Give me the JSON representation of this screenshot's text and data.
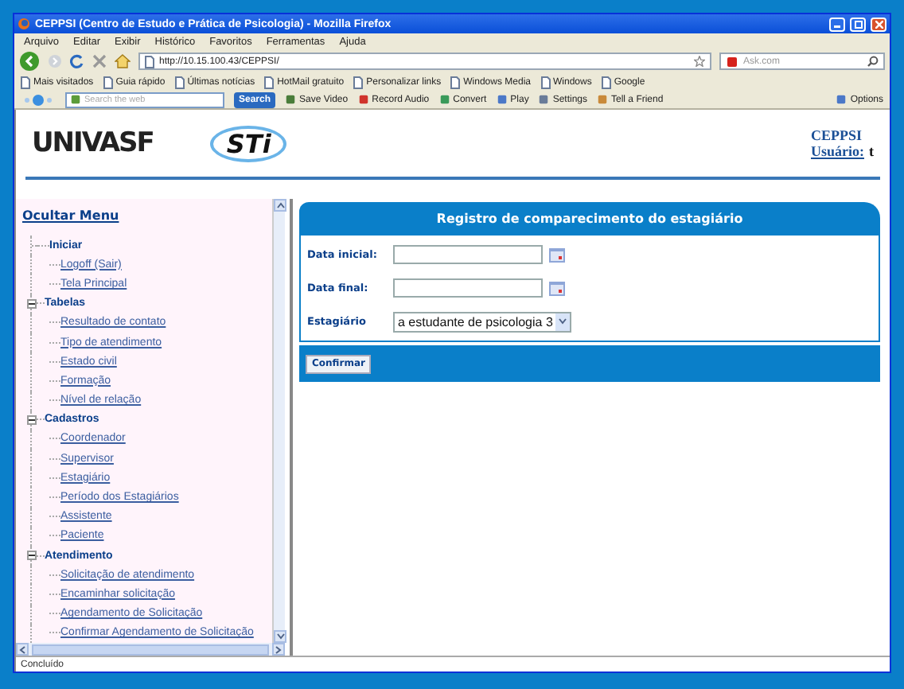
{
  "window": {
    "title": "CEPPSI (Centro de Estudo e Prática de Psicologia) - Mozilla Firefox"
  },
  "menu": [
    "Arquivo",
    "Editar",
    "Exibir",
    "Histórico",
    "Favoritos",
    "Ferramentas",
    "Ajuda"
  ],
  "address": {
    "value": "http://10.15.100.43/CEPPSI/"
  },
  "search": {
    "placeholder": "Ask.com"
  },
  "bookmarks": [
    "Mais visitados",
    "Guia rápido",
    "Últimas notícias",
    "HotMail gratuito",
    "Personalizar links",
    "Windows Media",
    "Windows",
    "Google"
  ],
  "ask_toolbar": {
    "search_placeholder": "Search the web",
    "search_button": "Search",
    "items": [
      "Save Video",
      "Record Audio",
      "Convert",
      "Play",
      "Settings",
      "Tell a Friend"
    ],
    "options": "Options"
  },
  "header": {
    "logos": [
      "UNIVASF",
      "STi"
    ],
    "site": "CEPPSI",
    "user_label": "Usuário:",
    "user": "t"
  },
  "sidebar": {
    "toggle": "Ocultar Menu",
    "groups": [
      {
        "label": "Iniciar",
        "kind": "plain",
        "expanded": true,
        "items": [
          "Logoff (Sair)",
          "Tela Principal"
        ]
      },
      {
        "label": "Tabelas",
        "kind": "collapsible",
        "expanded": true,
        "items": [
          "Resultado de contato",
          "Tipo de atendimento",
          "Estado civil",
          "Formação",
          "Nível de relação"
        ]
      },
      {
        "label": "Cadastros",
        "kind": "collapsible",
        "expanded": true,
        "items": [
          "Coordenador",
          "Supervisor",
          "Estagiário",
          "Período dos Estagiários",
          "Assistente",
          "Paciente"
        ]
      },
      {
        "label": "Atendimento",
        "kind": "collapsible",
        "expanded": true,
        "items": [
          "Solicitação de atendimento",
          "Encaminhar solicitação",
          "Agendamento de Solicitação",
          "Confirmar Agendamento de Solicitação"
        ]
      }
    ]
  },
  "form": {
    "title": "Registro de comparecimento do estagiário",
    "fields": [
      {
        "kind": "date",
        "label": "Data inicial:"
      },
      {
        "kind": "date",
        "label": "Data final:"
      },
      {
        "kind": "select",
        "label": "Estagiário",
        "value": "a estudante de psicologia 3"
      }
    ],
    "submit": "Confirmar"
  },
  "status_bar": {
    "text": "Concluído"
  }
}
